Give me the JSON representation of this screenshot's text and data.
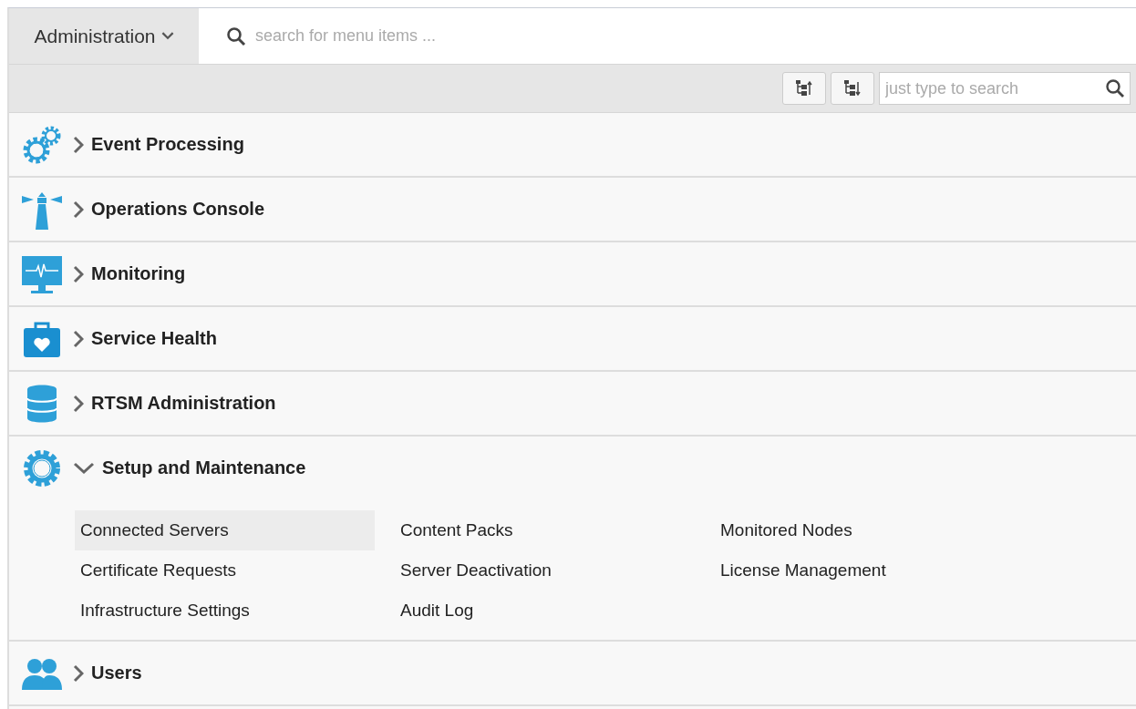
{
  "header": {
    "menu_label": "Administration",
    "search": {
      "placeholder": "search for menu items ..."
    }
  },
  "toolbar": {
    "filter": {
      "placeholder": "just type to search"
    }
  },
  "sections": [
    {
      "title": "Event Processing",
      "expanded": false
    },
    {
      "title": "Operations Console",
      "expanded": false
    },
    {
      "title": "Monitoring",
      "expanded": false
    },
    {
      "title": "Service Health",
      "expanded": false
    },
    {
      "title": "RTSM Administration",
      "expanded": false
    },
    {
      "title": "Setup and Maintenance",
      "expanded": true,
      "items": [
        {
          "label": "Connected Servers",
          "selected": true
        },
        {
          "label": "Content Packs",
          "selected": false
        },
        {
          "label": "Monitored Nodes",
          "selected": false
        },
        {
          "label": "Certificate Requests",
          "selected": false
        },
        {
          "label": "Server Deactivation",
          "selected": false
        },
        {
          "label": "License Management",
          "selected": false
        },
        {
          "label": "Infrastructure Settings",
          "selected": false
        },
        {
          "label": "Audit Log",
          "selected": false
        }
      ]
    },
    {
      "title": "Users",
      "expanded": false
    }
  ]
}
